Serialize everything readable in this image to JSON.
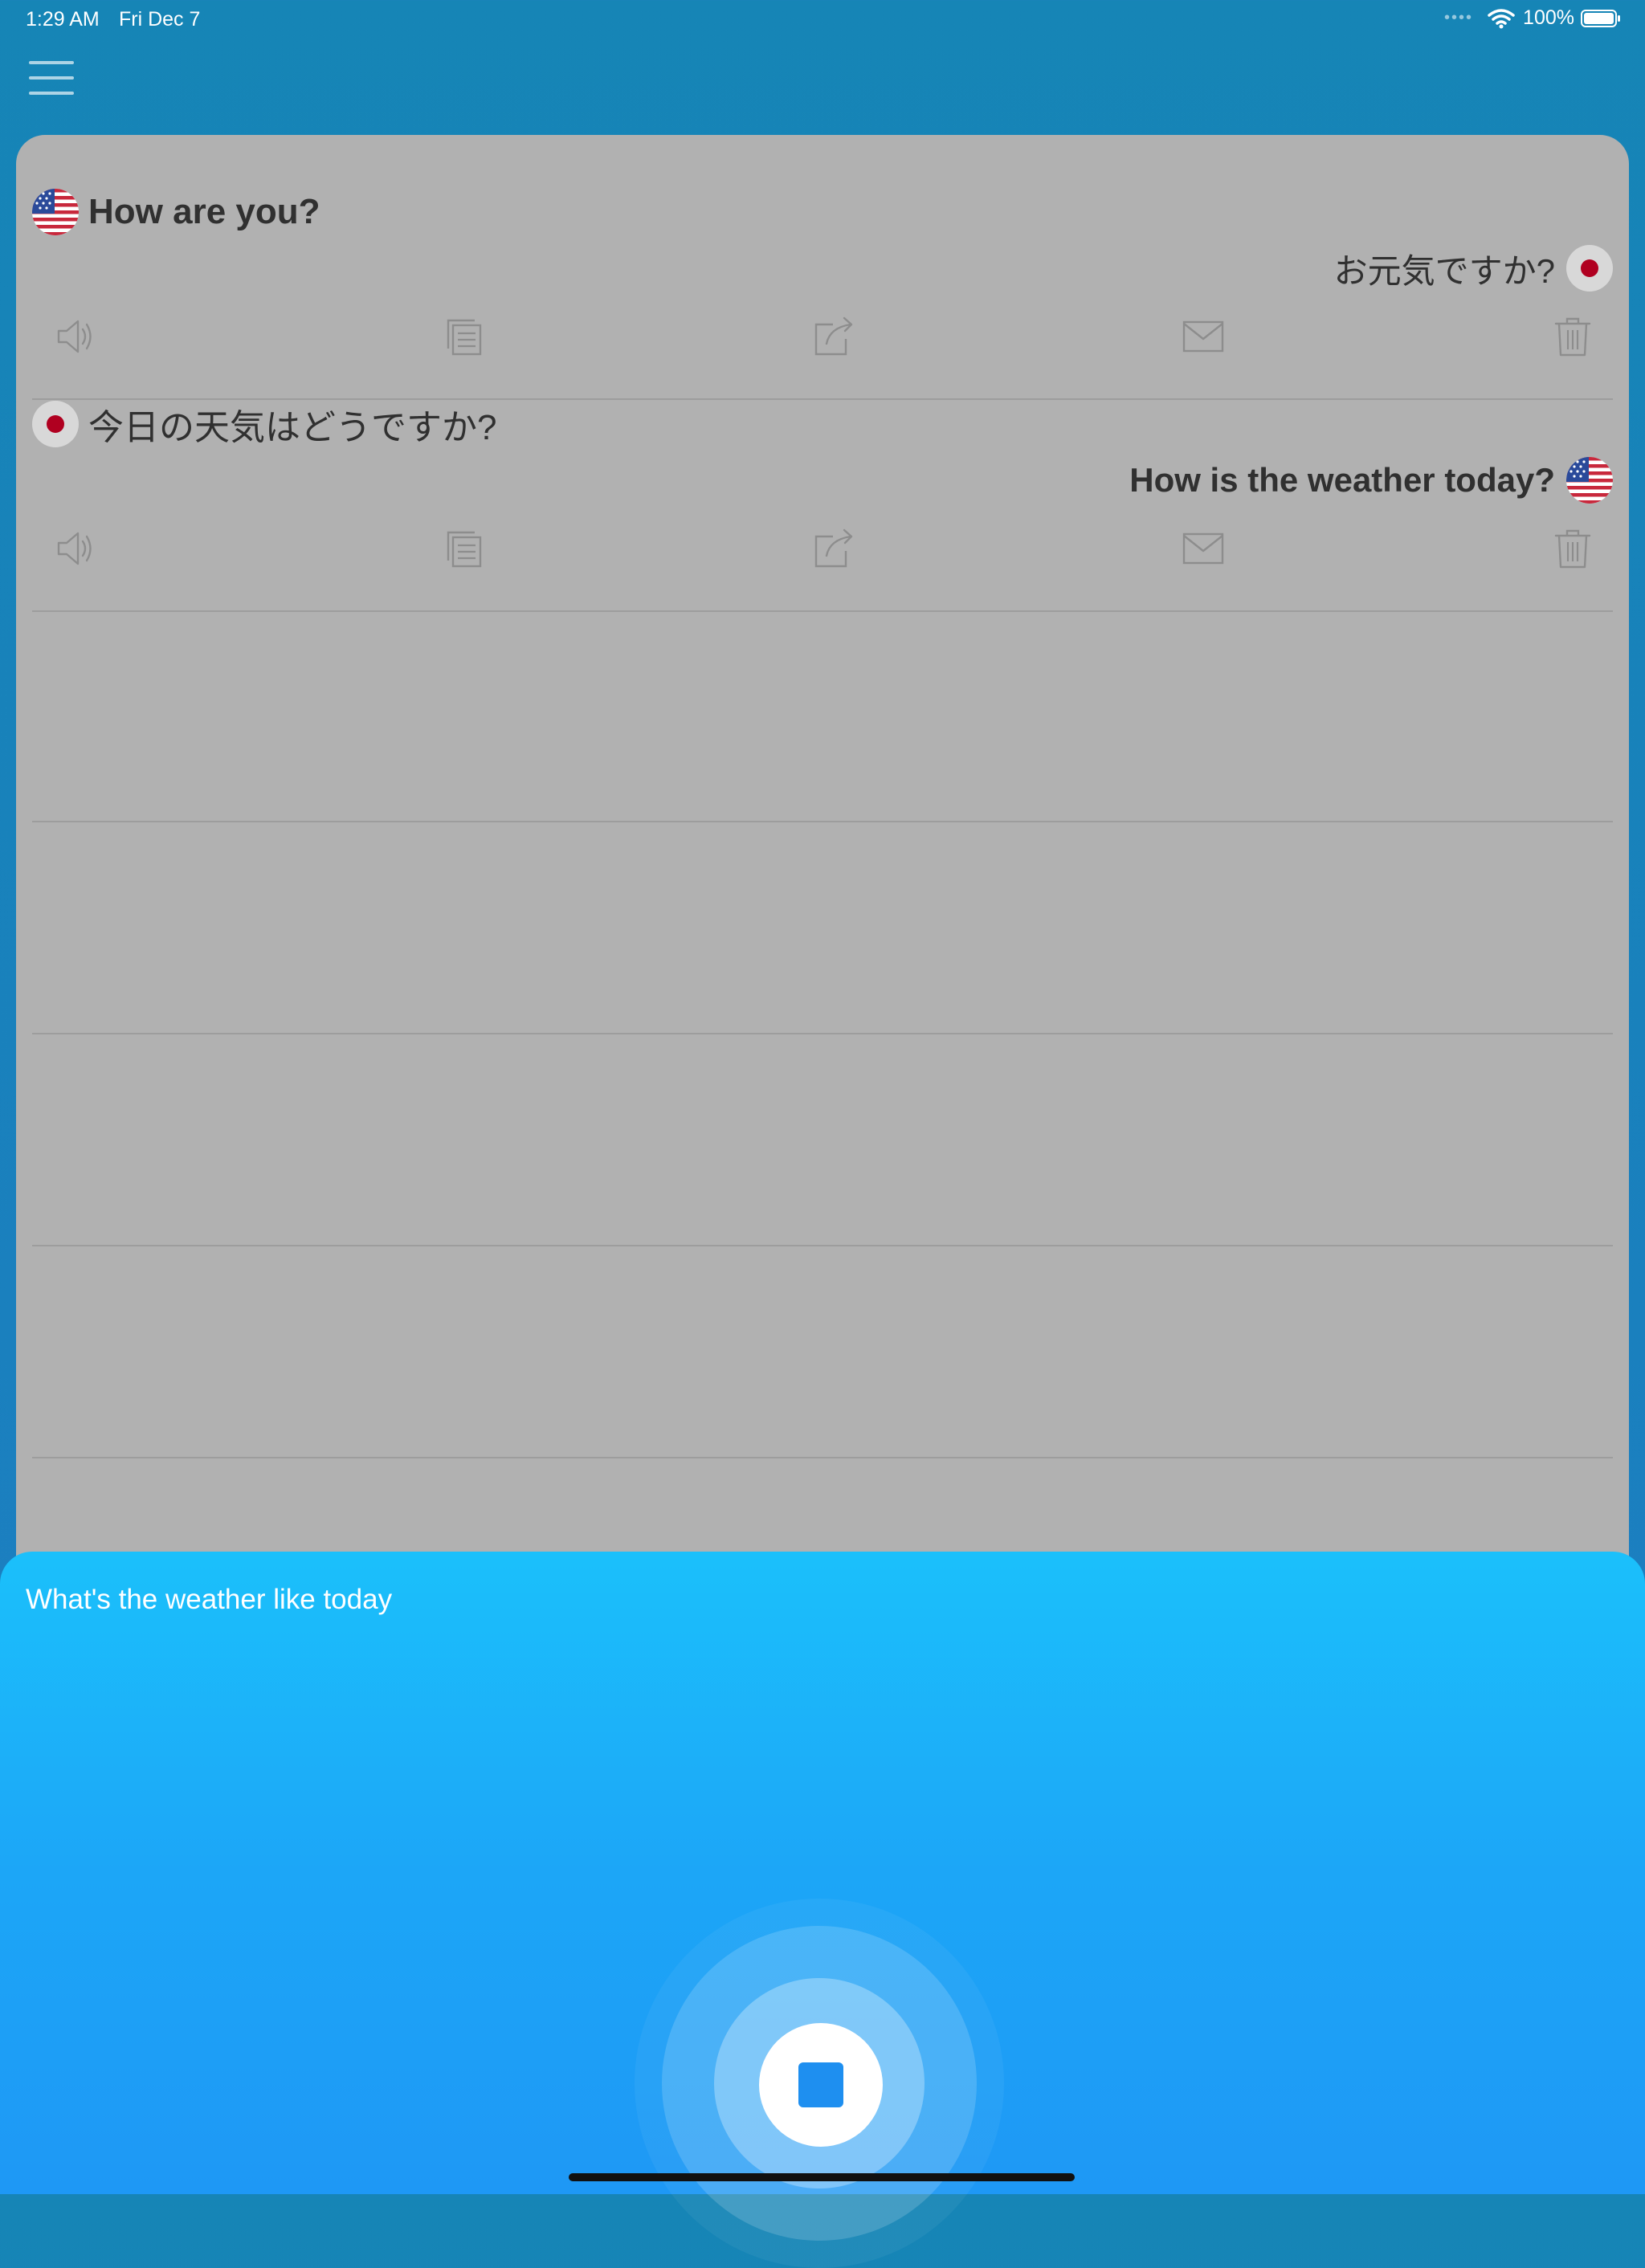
{
  "status_bar": {
    "time": "1:29 AM",
    "date": "Fri Dec 7",
    "battery": "100%"
  },
  "colors": {
    "app_background": "#1685b6",
    "card_background": "#b1b1b1",
    "sheet_top": "#1bc0fb",
    "sheet_bottom": "#1e98f5",
    "stop_icon": "#1e8ff0"
  },
  "conversation": {
    "entries": [
      {
        "source_text": "How are you?",
        "source_flag": "us-flag-icon",
        "translated_text": "お元気ですか?",
        "translated_flag": "japan-flag-icon"
      },
      {
        "source_text": "今日の天気はどうですか?",
        "source_flag": "japan-flag-icon",
        "translated_text": "How is the weather today?",
        "translated_flag": "us-flag-icon"
      }
    ],
    "actions": [
      "speaker-icon",
      "copy-icon",
      "share-icon",
      "mail-icon",
      "trash-icon"
    ]
  },
  "listening_sheet": {
    "recognized_text": "What's the weather like today"
  }
}
